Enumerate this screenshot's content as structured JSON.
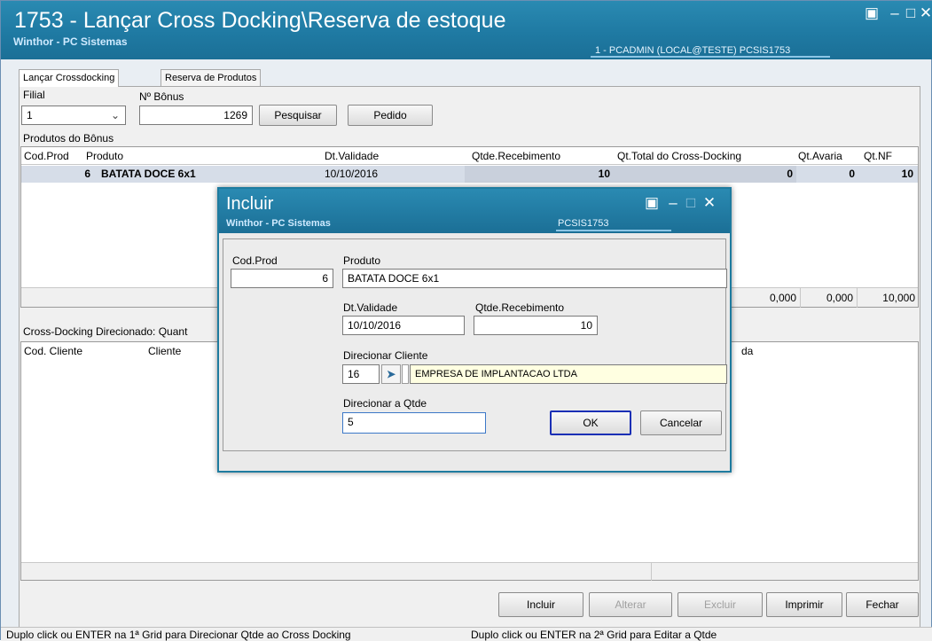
{
  "window": {
    "title": "1753 - Lançar Cross Docking\\Reserva de estoque",
    "subtitle": "Winthor - PC Sistemas",
    "user_info": "1 - PCADMIN (LOCAL@TESTE)   PCSIS1753"
  },
  "tabs": [
    "Lançar Crossdocking",
    "Reserva de Produtos"
  ],
  "form": {
    "filial_label": "Filial",
    "filial_value": "1",
    "bonus_label": "Nº Bônus",
    "bonus_value": "1269",
    "pesquisar_label": "Pesquisar",
    "pedido_label": "Pedido"
  },
  "produtos_grid": {
    "label": "Produtos do Bônus",
    "headers": [
      "Cod.Prod",
      "Produto",
      "Dt.Validade",
      "Qtde.Recebimento",
      "Qt.Total do Cross-Docking",
      "Qt.Avaria",
      "Qt.NF"
    ],
    "rows": [
      {
        "cod": "6",
        "produto": "BATATA DOCE 6x1",
        "validade": "10/10/2016",
        "receb": "10",
        "total_cross": "0",
        "avaria": "0",
        "nf": "10"
      }
    ],
    "totals": {
      "total_cross": "0,000",
      "avaria": "0,000",
      "nf": "10,000"
    }
  },
  "cross_grid": {
    "label": "Cross-Docking Direcionado: Quant",
    "headers": [
      "Cod. Cliente",
      "Cliente",
      "da"
    ]
  },
  "bottom_buttons": {
    "incluir": "Incluir",
    "alterar": "Alterar",
    "excluir": "Excluir",
    "imprimir": "Imprimir",
    "fechar": "Fechar"
  },
  "status": {
    "left": "Duplo click ou ENTER na 1ª Grid para Direcionar Qtde ao Cross Docking",
    "right": "Duplo click ou ENTER na 2ª Grid para Editar a Qtde"
  },
  "dialog": {
    "title": "Incluir",
    "subtitle": "Winthor - PC Sistemas",
    "code": "PCSIS1753",
    "cod_prod_label": "Cod.Prod",
    "cod_prod_value": "6",
    "produto_label": "Produto",
    "produto_value": "BATATA DOCE 6x1",
    "validade_label": "Dt.Validade",
    "validade_value": "10/10/2016",
    "receb_label": "Qtde.Recebimento",
    "receb_value": "10",
    "cliente_label": "Direcionar Cliente",
    "cliente_code": "16",
    "cliente_name": "EMPRESA DE IMPLANTACAO LTDA",
    "qtde_label": "Direcionar a Qtde",
    "qtde_value": "5",
    "ok_label": "OK",
    "cancel_label": "Cancelar"
  },
  "colors": {
    "titlebar": "#1f7aa3",
    "selected_row": "#d6dde8",
    "client_name_bg": "#ffffe1",
    "ok_focus": "#1a2fb5"
  }
}
